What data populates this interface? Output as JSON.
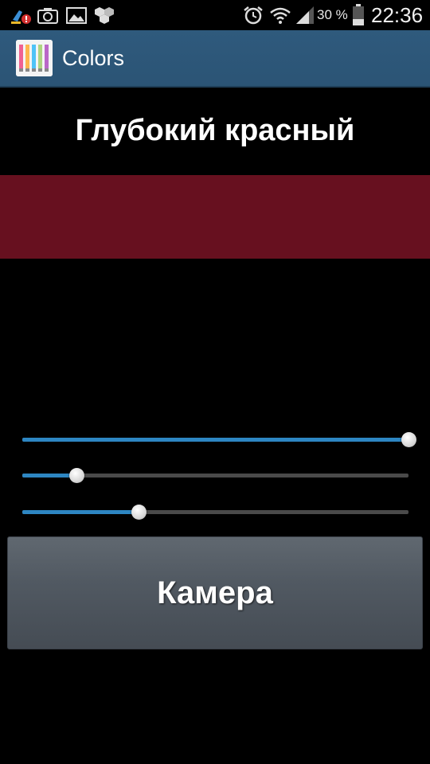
{
  "status_bar": {
    "battery_percent": "30 %",
    "time": "22:36",
    "icons": [
      "cleaner-alert-icon",
      "camera-icon",
      "gallery-icon",
      "hex-app-icon",
      "alarm-icon",
      "wifi-icon",
      "signal-icon",
      "battery-icon"
    ]
  },
  "action_bar": {
    "title": "Colors",
    "icon": "paint-tubes-icon"
  },
  "color": {
    "name": "Глубокий красный",
    "swatch_hex": "#67101f"
  },
  "sliders": [
    {
      "name": "red",
      "level": 1.0,
      "fill_color": "#2d86c2"
    },
    {
      "name": "green",
      "level": 0.14,
      "fill_color": "#2d86c2"
    },
    {
      "name": "blue",
      "level": 0.3,
      "fill_color": "#2d86c2"
    }
  ],
  "camera_button": {
    "label": "Камера"
  },
  "colors": {
    "action_bar": "#2f5a7d",
    "background": "#000000",
    "slider_track": "#4a4a4a",
    "slider_fill": "#2d86c2"
  }
}
